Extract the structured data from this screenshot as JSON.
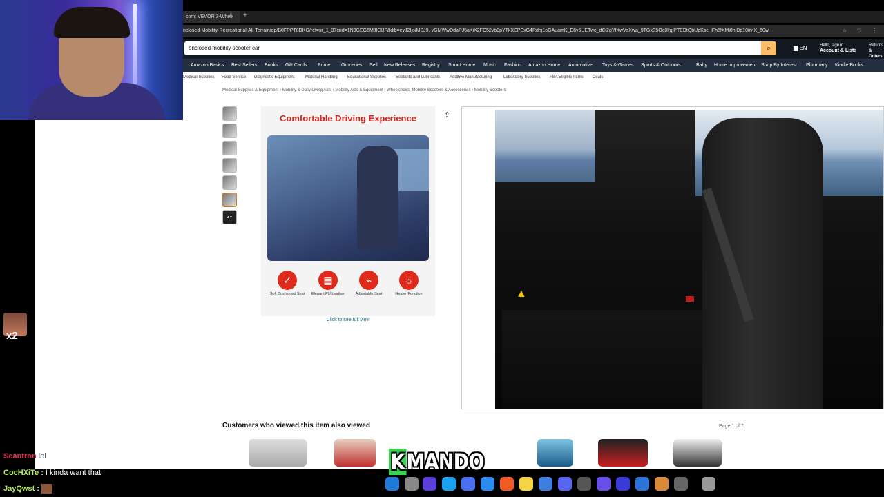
{
  "browser": {
    "tab_label": "com: VEVOR 3-Whee",
    "tab_close": "×",
    "tab_new": "+",
    "url": "nclosed-Mobility-Recreational-All-Terrain/dp/B0FPPT8DKG/ref=sr_1_37crid=1N9GEG6MJICUF&dib=eyJ2IjoiMSJ9.-yGMWwDdaPJ5aKiK2FC52yb0pYTkXEPExG4Rdhj1oGAuamK_E6v5UETwc_dCi2qYfXwVsXwa_9TGxE5Oc0lfgjPTEDtQbUpKscHFh5fXMi8hiDp10iivIX_60w",
    "url_icons": "☆ ♡ ⋮"
  },
  "amazon": {
    "search_value": "enclosed mobility scooter car",
    "search_icon": "search-icon",
    "lang": "EN",
    "account_greeting": "Hello, sign in",
    "account_label": "Account & Lists",
    "returns_label": "Returns",
    "orders_label": "& Orders",
    "nav": [
      "Amazon Basics",
      "Best Sellers",
      "Books",
      "Gift Cards",
      "Prime",
      "Groceries",
      "Sell",
      "New Releases",
      "Registry",
      "Smart Home",
      "Music",
      "Fashion",
      "Amazon Home",
      "Automotive",
      "Toys & Games",
      "Sports & Outdoors",
      "Baby",
      "Home Improvement",
      "Shop By Interest",
      "Pharmacy",
      "Kindle Books"
    ],
    "subnav": [
      "Medical Supplies",
      "Food Service",
      "Diagnostic Equipment",
      "Material Handling",
      "Educational Supplies",
      "Sealants and Lubricants",
      "Additive Manufacturing",
      "Laboratory Supplies",
      "FSA Eligible Items",
      "Deals"
    ],
    "breadcrumb": "Medical Supplies & Equipment  ›  Mobility & Daily Living Aids  ›  Mobility Aids & Equipment  ›  Wheelchairs, Mobility Scooters & Accessories  ›  Mobility Scooters"
  },
  "product": {
    "more_thumbs": "3+",
    "promo_title": "Comfortable Driving Experience",
    "features": [
      {
        "icon": "✓",
        "label": "Soft Cushioned Seat"
      },
      {
        "icon": "▦",
        "label": "Elegant PU Leather"
      },
      {
        "icon": "⌁",
        "label": "Adjustable Seat"
      },
      {
        "icon": "☼",
        "label": "Heater Function"
      }
    ],
    "full_view_link": "Click to see full view",
    "share_icon": "⇪"
  },
  "also_viewed": {
    "title": "Customers who viewed this item also viewed",
    "page": "Page 1 of 7"
  },
  "chat": {
    "badge": "x2",
    "lines": [
      {
        "user": "Scantron",
        "msg": "lol"
      },
      {
        "user": "CocHXiTe :",
        "msg": "I kinda want that"
      },
      {
        "user": "JayQwst :",
        "msg": ""
      }
    ]
  },
  "watermark": {
    "k": "K",
    "rest": "MANDO"
  },
  "colors": {
    "amazon_dark": "#131921",
    "amazon_nav": "#232f3e",
    "promo_red": "#d9261c",
    "link": "#007185"
  }
}
